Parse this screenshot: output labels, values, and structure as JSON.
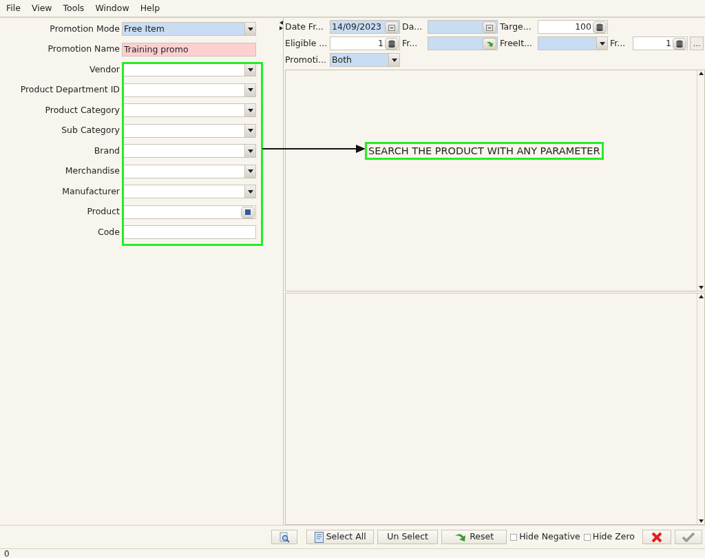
{
  "menu": [
    "File",
    "View",
    "Tools",
    "Window",
    "Help"
  ],
  "form": [
    {
      "label": "Promotion Mode",
      "kind": "combo",
      "value": "Free Item",
      "highlighted": true,
      "mandatory": false
    },
    {
      "label": "Promotion Name",
      "kind": "text",
      "value": "Training promo",
      "highlighted": false,
      "mandatory": true
    },
    {
      "label": "Vendor",
      "kind": "combo",
      "highlighted": false,
      "mandatory": false
    },
    {
      "label": "Product Department ID",
      "kind": "combo",
      "highlighted": false,
      "mandatory": false
    },
    {
      "label": "Product Category",
      "kind": "combo",
      "highlighted": false,
      "mandatory": false
    },
    {
      "label": "Sub Category",
      "kind": "combo",
      "highlighted": false,
      "mandatory": false
    },
    {
      "label": "Brand",
      "kind": "combo",
      "highlighted": false,
      "mandatory": false
    },
    {
      "label": "Merchandise",
      "kind": "combo",
      "highlighted": false,
      "mandatory": false
    },
    {
      "label": "Manufacturer",
      "kind": "combo",
      "highlighted": false,
      "mandatory": false
    },
    {
      "label": "Product",
      "kind": "lookup",
      "highlighted": false,
      "mandatory": false
    },
    {
      "label": "Code",
      "kind": "text",
      "highlighted": false,
      "mandatory": false
    }
  ],
  "annotation": {
    "text": "SEARCH THE PRODUCT WITH ANY PARAMETER"
  },
  "header_rows": [
    [
      {
        "label": "Date Fr...",
        "kind": "date",
        "value": "14/09/2023",
        "highlighted": true
      },
      {
        "label": "Da...",
        "kind": "date",
        "highlighted": true
      },
      {
        "label": "Targe...",
        "kind": "number",
        "value": "100",
        "highlighted": false
      }
    ],
    [
      {
        "label": "Eligible ...",
        "kind": "number",
        "value": "1",
        "highlighted": false
      },
      {
        "label": "Fr...",
        "kind": "action",
        "highlighted": true
      },
      {
        "label": "FreeIt...",
        "kind": "combo",
        "highlighted": true
      },
      {
        "label": "Fr...",
        "kind": "number",
        "value": "1",
        "highlighted": false,
        "more": "..."
      }
    ],
    [
      {
        "label": "Promoti...",
        "kind": "combo",
        "value": "Both",
        "highlighted": true
      }
    ]
  ],
  "toolbar": [
    {
      "kind": "zoom"
    },
    {
      "kind": "select",
      "label": "Select All"
    },
    {
      "kind": "plain",
      "label": "Un Select"
    },
    {
      "kind": "reset",
      "label": "Reset"
    },
    {
      "kind": "checkbox",
      "label": "Hide Negative",
      "checked": false
    },
    {
      "kind": "checkbox",
      "label": "Hide Zero",
      "checked": false
    },
    {
      "kind": "cancel"
    },
    {
      "kind": "ok",
      "disabled": true
    }
  ],
  "status_bar": "0"
}
